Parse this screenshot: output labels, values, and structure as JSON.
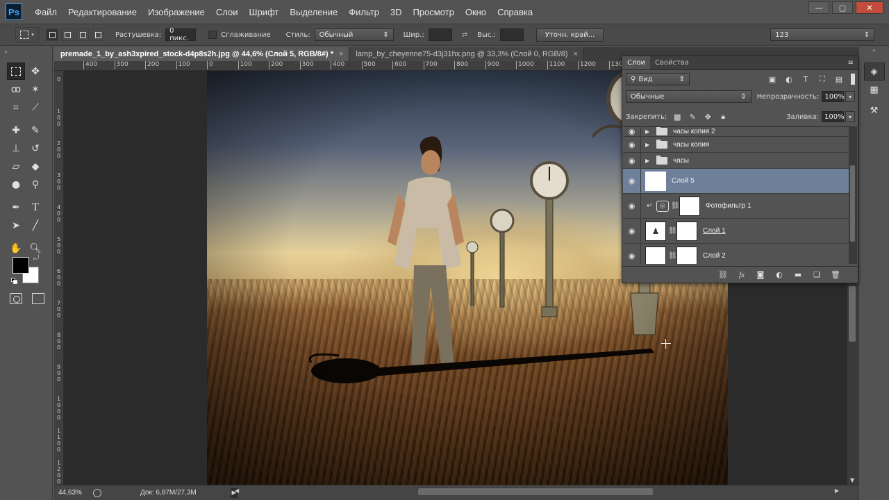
{
  "app": {
    "logo": "Ps"
  },
  "menu": [
    "Файл",
    "Редактирование",
    "Изображение",
    "Слои",
    "Шрифт",
    "Выделение",
    "Фильтр",
    "3D",
    "Просмотр",
    "Окно",
    "Справка"
  ],
  "window_controls": {
    "minimize": "—",
    "maximize": "▢",
    "close": "✕"
  },
  "options_bar": {
    "feather_label": "Растушевка:",
    "feather_value": "0 пикс.",
    "antialias_label": "Сглаживание",
    "style_label": "Стиль:",
    "style_value": "Обычный",
    "width_label": "Шир.:",
    "height_label": "Выс.:",
    "refine_edge_button": "Уточн. край...",
    "workspace_value": "123"
  },
  "documents": [
    {
      "title": "premade_1_by_ash3xpired_stock-d4p8s2h.jpg @ 44,6% (Слой 5, RGB/8#) *",
      "close": "×"
    },
    {
      "title": "lamp_by_cheyenne75-d3j31hx.png @ 33,3% (Слой 0, RGB/8)",
      "close": "×"
    }
  ],
  "ruler_top_labels": [
    "400",
    "300",
    "200",
    "100",
    "0",
    "100",
    "200",
    "300",
    "400",
    "500",
    "600",
    "700",
    "800",
    "900",
    "1000",
    "1100",
    "1200",
    "130"
  ],
  "ruler_left_labels": [
    "0",
    "1 0 0",
    "2 0 0",
    "3 0 0",
    "4 0 0",
    "5 0 0",
    "6 0 0",
    "7 0 0",
    "8 0 0",
    "9 0 0",
    "1 0 0 0",
    "1 1 0 0",
    "1 2 0 0"
  ],
  "status": {
    "zoom": "44,63%",
    "doc_size": "Док: 6,87M/27,3M",
    "arrow": "▶"
  },
  "layers_panel": {
    "tabs": [
      "Слои",
      "Свойства"
    ],
    "menu_icon": "≡",
    "filter_kind": "Вид",
    "blend_mode": "Обычные",
    "opacity_label": "Непрозрачность:",
    "opacity_value": "100%",
    "lock_label": "Закрепить:",
    "fill_label": "Заливка:",
    "fill_value": "100%",
    "layers": [
      {
        "name": "часы копия 2",
        "kind": "group",
        "visible": true
      },
      {
        "name": "часы копия",
        "kind": "group",
        "visible": true
      },
      {
        "name": "часы",
        "kind": "group",
        "visible": true
      },
      {
        "name": "Слой 5",
        "kind": "pixel",
        "visible": true,
        "selected": true
      },
      {
        "name": "Фотофильтр 1",
        "kind": "adjustment",
        "visible": true
      },
      {
        "name": "Слой 1",
        "kind": "masked",
        "visible": true
      },
      {
        "name": "Слой 2",
        "kind": "masked",
        "visible": true
      }
    ]
  },
  "colors": {
    "foreground": "#000000",
    "background": "#ffffff",
    "selected_layer": "#6d7f99",
    "panel": "#535353"
  }
}
